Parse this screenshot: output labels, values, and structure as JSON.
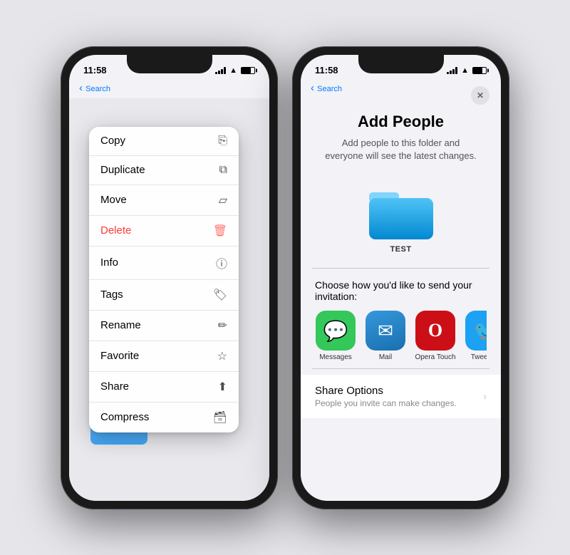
{
  "page": {
    "background": "#e5e5ea"
  },
  "phone_left": {
    "status": {
      "time": "11:58",
      "nav_label": "Search"
    },
    "context_menu": {
      "items": [
        {
          "label": "Copy",
          "icon": "📋",
          "style": "normal"
        },
        {
          "label": "Duplicate",
          "icon": "⧉",
          "style": "normal"
        },
        {
          "label": "Move",
          "icon": "🗂",
          "style": "normal"
        },
        {
          "label": "Delete",
          "icon": "🗑",
          "style": "delete"
        },
        {
          "label": "Info",
          "icon": "ⓘ",
          "style": "normal"
        },
        {
          "label": "Tags",
          "icon": "🏷",
          "style": "normal"
        },
        {
          "label": "Rename",
          "icon": "✏",
          "style": "normal"
        },
        {
          "label": "Favorite",
          "icon": "☆",
          "style": "normal"
        },
        {
          "label": "Share",
          "icon": "⬆",
          "style": "normal"
        },
        {
          "label": "Compress",
          "icon": "🗃",
          "style": "normal"
        }
      ]
    }
  },
  "phone_right": {
    "status": {
      "time": "11:58",
      "nav_label": "Search"
    },
    "add_people": {
      "title": "Add People",
      "subtitle": "Add people to this folder and everyone will see the latest changes.",
      "folder_name": "TEST",
      "close_button": "✕",
      "share_prompt": "Choose how you'd like to send your invitation:",
      "apps": [
        {
          "name": "Messages",
          "icon": "💬",
          "style": "messages"
        },
        {
          "name": "Mail",
          "icon": "✉",
          "style": "mail"
        },
        {
          "name": "Opera Touch",
          "icon": "O",
          "style": "opera"
        },
        {
          "name": "Tweetbot",
          "icon": "🐦",
          "style": "tweetbot"
        }
      ],
      "share_options": {
        "title": "Share Options",
        "subtitle": "People you invite can make changes."
      }
    }
  }
}
